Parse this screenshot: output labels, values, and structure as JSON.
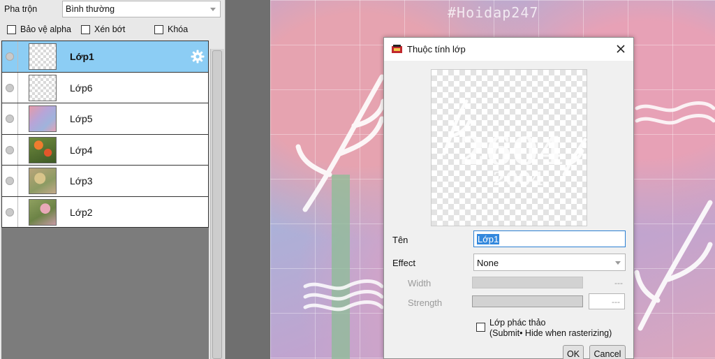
{
  "layer_panel": {
    "blend_label": "Pha trộn",
    "blend_mode": "Bình thường",
    "options": {
      "protect_alpha": "Bảo vệ alpha",
      "clip": "Xén bớt",
      "lock": "Khóa"
    },
    "layers": [
      {
        "name": "Lớp1",
        "selected": true,
        "thumb": "transparent"
      },
      {
        "name": "Lớp6",
        "selected": false,
        "thumb": "transparent"
      },
      {
        "name": "Lớp5",
        "selected": false,
        "thumb": "pink-tulip-photo"
      },
      {
        "name": "Lớp4",
        "selected": false,
        "thumb": "orange-flower-photo"
      },
      {
        "name": "Lớp3",
        "selected": false,
        "thumb": "beige-flower-photo"
      },
      {
        "name": "Lớp2",
        "selected": false,
        "thumb": "pink-flower-photo"
      }
    ],
    "icons": {
      "settings": "gear-icon",
      "visibility": "eye-dot-icon"
    }
  },
  "canvas": {
    "watermark": "#Hoidap247"
  },
  "dialog": {
    "title": "Thuộc tính lớp",
    "name_label": "Tên",
    "name_value": "Lớp1",
    "effect_label": "Effect",
    "effect_value": "None",
    "width_label": "Width",
    "width_value": "---",
    "strength_label": "Strength",
    "strength_value": "---",
    "draft_checkbox_label_line1": "Lớp phác thảo",
    "draft_checkbox_label_line2": "(Submit• Hide when rasterizing)",
    "ok_label": "OK",
    "cancel_label": "Cancel",
    "preview_text_large": "2604",
    "preview_text_small": "2004"
  },
  "colors": {
    "selected_row": "#8ccdf4",
    "input_focus": "#2b7fd2",
    "text_selection": "#3388dd"
  }
}
